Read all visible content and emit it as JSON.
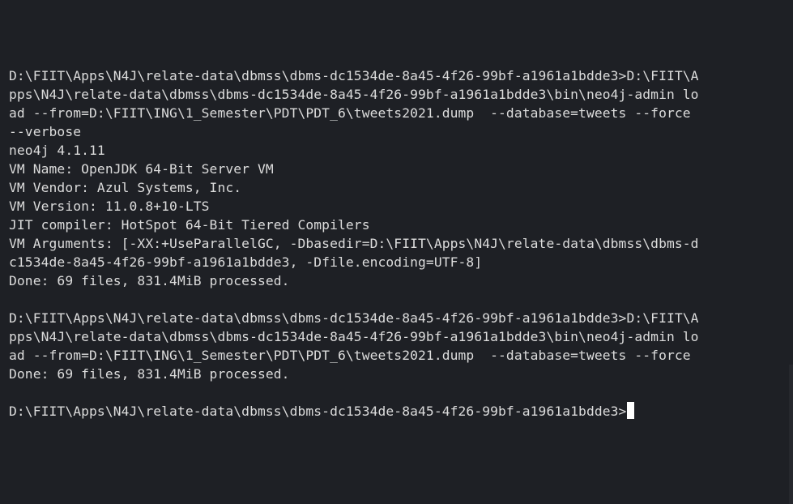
{
  "terminal": {
    "lines": [
      "D:\\FIIT\\Apps\\N4J\\relate-data\\dbmss\\dbms-dc1534de-8a45-4f26-99bf-a1961a1bdde3>D:\\FIIT\\A",
      "pps\\N4J\\relate-data\\dbmss\\dbms-dc1534de-8a45-4f26-99bf-a1961a1bdde3\\bin\\neo4j-admin lo",
      "ad --from=D:\\FIIT\\ING\\1_Semester\\PDT\\PDT_6\\tweets2021.dump  --database=tweets --force",
      "--verbose",
      "neo4j 4.1.11",
      "VM Name: OpenJDK 64-Bit Server VM",
      "VM Vendor: Azul Systems, Inc.",
      "VM Version: 11.0.8+10-LTS",
      "JIT compiler: HotSpot 64-Bit Tiered Compilers",
      "VM Arguments: [-XX:+UseParallelGC, -Dbasedir=D:\\FIIT\\Apps\\N4J\\relate-data\\dbmss\\dbms-d",
      "c1534de-8a45-4f26-99bf-a1961a1bdde3, -Dfile.encoding=UTF-8]",
      "Done: 69 files, 831.4MiB processed.",
      "",
      "D:\\FIIT\\Apps\\N4J\\relate-data\\dbmss\\dbms-dc1534de-8a45-4f26-99bf-a1961a1bdde3>D:\\FIIT\\A",
      "pps\\N4J\\relate-data\\dbmss\\dbms-dc1534de-8a45-4f26-99bf-a1961a1bdde3\\bin\\neo4j-admin lo",
      "ad --from=D:\\FIIT\\ING\\1_Semester\\PDT\\PDT_6\\tweets2021.dump  --database=tweets --force",
      "Done: 69 files, 831.4MiB processed.",
      ""
    ],
    "prompt": "D:\\FIIT\\Apps\\N4J\\relate-data\\dbmss\\dbms-dc1534de-8a45-4f26-99bf-a1961a1bdde3>"
  },
  "colors": {
    "background": "#1e2025",
    "text": "#dcdcdc",
    "cursor": "#ffffff"
  }
}
